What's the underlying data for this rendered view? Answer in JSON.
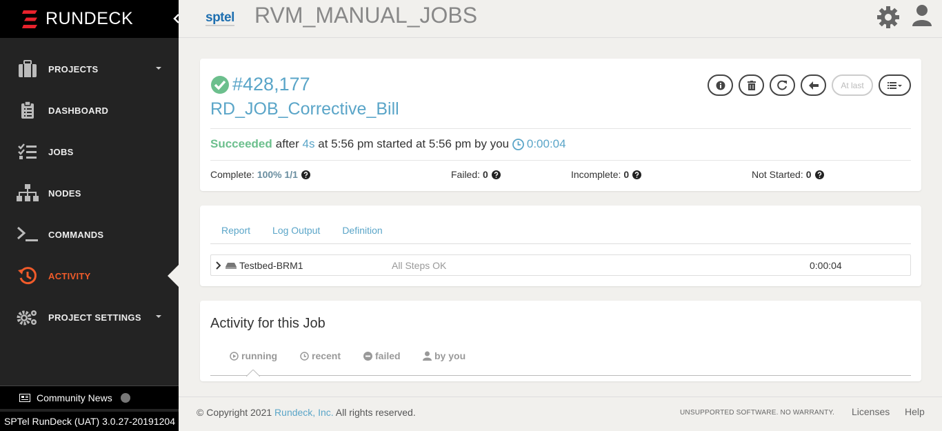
{
  "sidebar": {
    "brand": "RUNDECK",
    "items": [
      {
        "label": "PROJECTS",
        "icon": "briefcase-icon"
      },
      {
        "label": "DASHBOARD",
        "icon": "clipboard-icon"
      },
      {
        "label": "JOBS",
        "icon": "tasks-icon"
      },
      {
        "label": "NODES",
        "icon": "sitemap-icon"
      },
      {
        "label": "COMMANDS",
        "icon": "terminal-icon"
      },
      {
        "label": "ACTIVITY",
        "icon": "history-icon"
      },
      {
        "label": "PROJECT SETTINGS",
        "icon": "cogs-icon"
      }
    ],
    "news": "Community News",
    "version": "SPTel RunDeck (UAT) 3.0.27-20191204"
  },
  "header": {
    "project_logo_text": "sptel",
    "project_title": "RVM_MANUAL_JOBS"
  },
  "execution": {
    "id": "#428,177",
    "job_name": "RD_JOB_Corrective_Bill",
    "status": "Succeeded",
    "after": "after",
    "duration_short": "4s",
    "at_time": "at 5:56 pm started at 5:56 pm by you",
    "elapsed": "0:00:04",
    "at_last_label": "At last",
    "complete_label": "Complete:",
    "complete_value": "100% 1/1",
    "failed_label": "Failed:",
    "failed_value": "0",
    "incomplete_label": "Incomplete:",
    "incomplete_value": "0",
    "not_started_label": "Not Started:",
    "not_started_value": "0"
  },
  "output": {
    "tabs": [
      "Report",
      "Log Output",
      "Definition"
    ],
    "node": "Testbed-BRM1",
    "node_status": "All Steps OK",
    "node_duration": "0:00:04"
  },
  "activity": {
    "title": "Activity for this Job",
    "tabs": [
      "running",
      "recent",
      "failed",
      "by you"
    ]
  },
  "footer": {
    "copyright_prefix": "© Copyright 2021",
    "company": "Rundeck, Inc.",
    "rights": "All rights reserved.",
    "warranty": "UNSUPPORTED SOFTWARE. NO WARRANTY.",
    "licenses": "Licenses",
    "help": "Help"
  },
  "colors": {
    "accent": "#5aa5c8",
    "success": "#6cbf8d",
    "active_nav": "#f15b2a",
    "sidebar_bg": "#232323"
  }
}
